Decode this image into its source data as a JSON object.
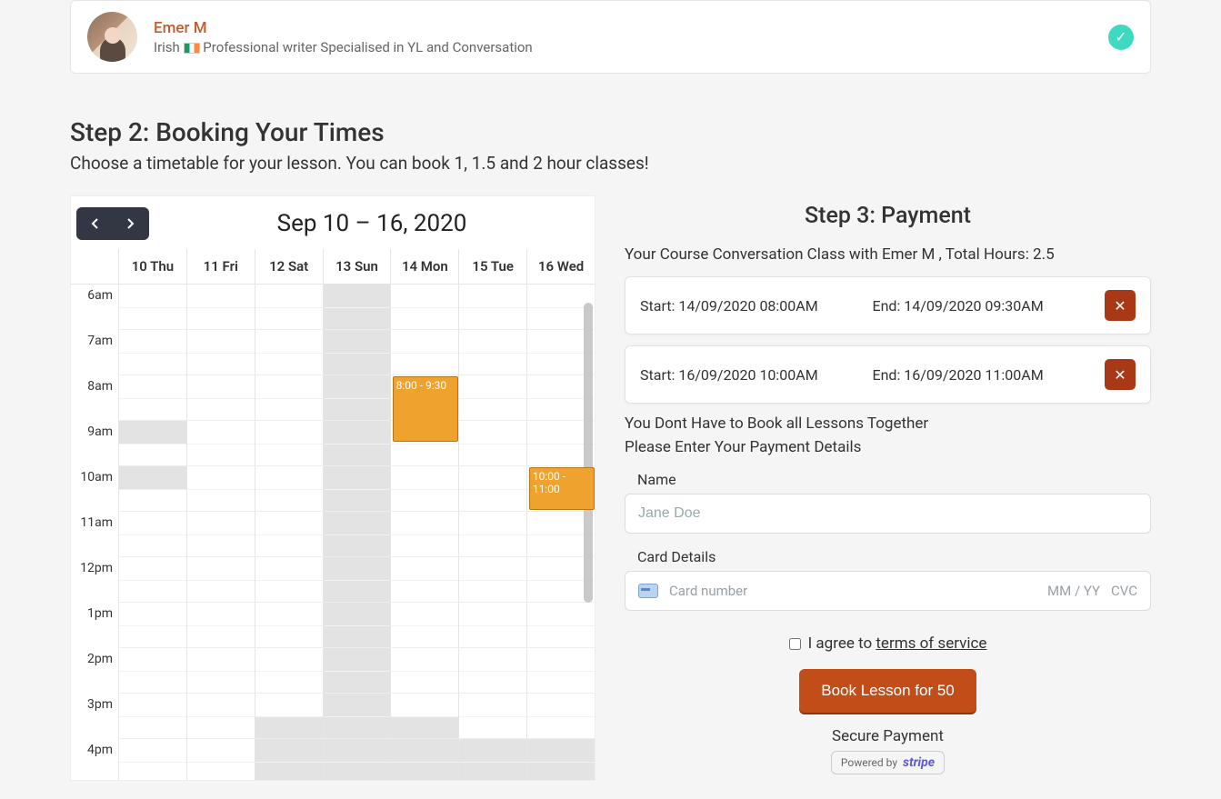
{
  "teacher": {
    "name": "Emer M",
    "nationality": "Irish",
    "bio": "Professional writer Specialised in YL and Conversation"
  },
  "step2": {
    "title": "Step 2: Booking Your Times",
    "sub": "Choose a timetable for your lesson. You can book 1, 1.5 and 2 hour classes!"
  },
  "calendar": {
    "range": "Sep 10 – 16, 2020",
    "days": [
      "10 Thu",
      "11 Fri",
      "12 Sat",
      "13 Sun",
      "14 Mon",
      "15 Tue",
      "16 Wed"
    ],
    "hours": [
      "6am",
      "7am",
      "8am",
      "9am",
      "10am",
      "11am",
      "12pm",
      "1pm",
      "2pm",
      "3pm",
      "4pm"
    ],
    "events": [
      {
        "day_index": 4,
        "hour_index": 2,
        "duration_halves": 3,
        "label": "8:00 - 9:30"
      },
      {
        "day_index": 6,
        "hour_index": 4,
        "duration_halves": 2,
        "label": "10:00 - 11:00"
      }
    ]
  },
  "step3": {
    "title": "Step 3: Payment",
    "summary": "Your Course Conversation Class with Emer M , Total Hours: 2.5",
    "bookings": [
      {
        "start": "Start: 14/09/2020 08:00AM",
        "end": "End: 14/09/2020 09:30AM"
      },
      {
        "start": "Start: 16/09/2020 10:00AM",
        "end": "End: 16/09/2020 11:00AM"
      }
    ],
    "note1": "You Dont Have to Book all Lessons Together",
    "note2": "Please Enter Your Payment Details",
    "name_label": "Name",
    "name_placeholder": "Jane Doe",
    "card_label": "Card Details",
    "card_number_ph": "Card number",
    "card_exp_ph": "MM / YY",
    "card_cvc_ph": "CVC",
    "tos_prefix": "I agree to ",
    "tos_link": "terms of service",
    "book_btn": "Book Lesson for 50",
    "secure": "Secure Payment",
    "powered": "Powered by",
    "stripe": "stripe"
  }
}
